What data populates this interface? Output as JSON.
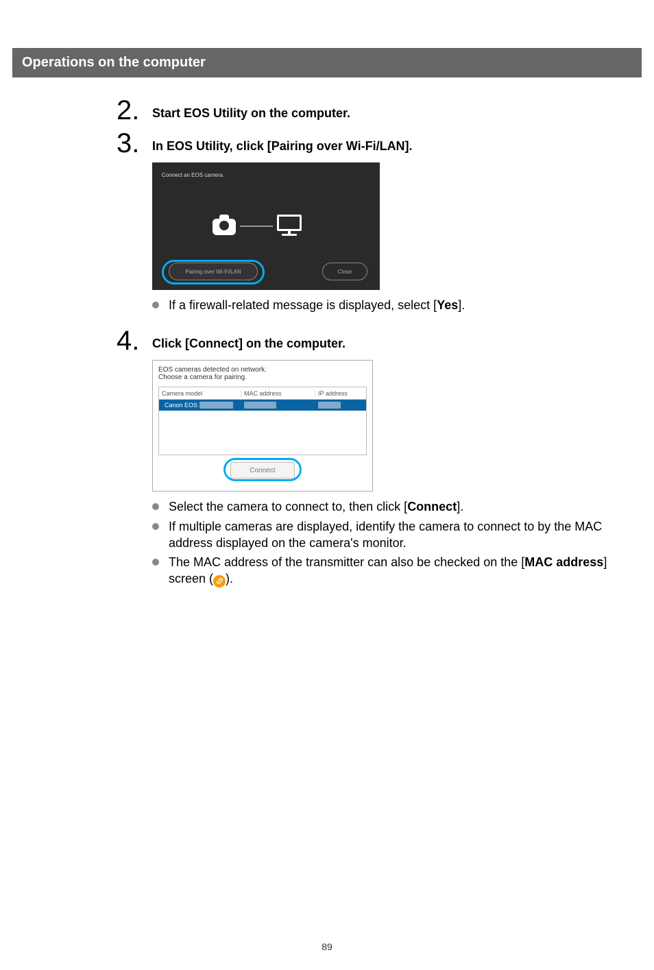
{
  "section_header": "Operations on the computer",
  "steps": {
    "s2": {
      "num": "2.",
      "title": "Start EOS Utility on the computer."
    },
    "s3": {
      "num": "3.",
      "title": "In EOS Utility, click [Pairing over Wi-Fi/LAN]."
    },
    "s4": {
      "num": "4.",
      "title": "Click [Connect] on the computer."
    }
  },
  "eos_dark": {
    "title": "Connect an EOS camera.",
    "pairing_btn": "Pairing over Wi-Fi/LAN",
    "close_btn": "Close"
  },
  "s3_bullets": {
    "b1_pre": "If a firewall-related message is displayed, select [",
    "b1_bold": "Yes",
    "b1_post": "]."
  },
  "light_dialog": {
    "line1": "EOS cameras detected on network.",
    "line2": "Choose a camera for pairing.",
    "col1": "Camera model",
    "col2": "MAC address",
    "col3": "IP address",
    "row1": "Canon EOS",
    "connect": "Connect"
  },
  "s4_bullets": {
    "b1_pre": "Select the camera to connect to, then click [",
    "b1_bold": "Connect",
    "b1_post": "].",
    "b2": "If multiple cameras are displayed, identify the camera to connect to by the MAC address displayed on the camera's monitor.",
    "b3_pre": "The MAC address of the transmitter can also be checked on the [",
    "b3_bold": "MAC address",
    "b3_mid": "] screen (",
    "b3_post": ")."
  },
  "page_number": "89"
}
